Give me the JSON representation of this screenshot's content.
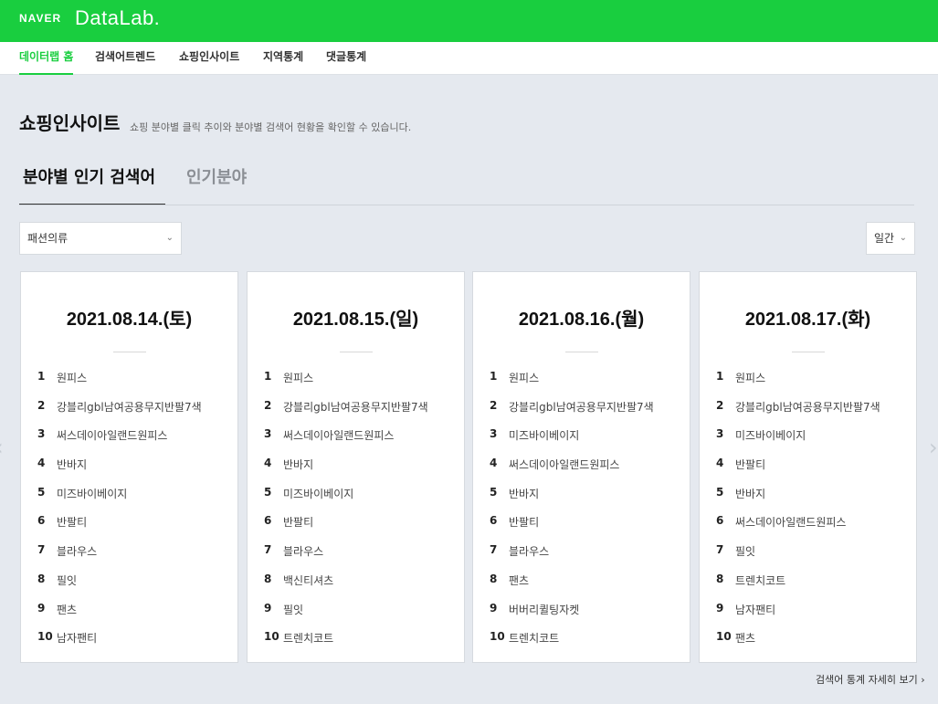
{
  "header": {
    "brand": "NAVER",
    "product": "DataLab."
  },
  "nav": {
    "items": [
      {
        "label": "데이터랩 홈",
        "active": true
      },
      {
        "label": "검색어트렌드",
        "active": false
      },
      {
        "label": "쇼핑인사이트",
        "active": false
      },
      {
        "label": "지역통계",
        "active": false
      },
      {
        "label": "댓글통계",
        "active": false
      }
    ]
  },
  "page": {
    "title": "쇼핑인사이트",
    "description": "쇼핑 분야별 클릭 추이와 분야별 검색어 현황을 확인할 수 있습니다."
  },
  "tabs": [
    {
      "label": "분야별 인기 검색어",
      "active": true
    },
    {
      "label": "인기분야",
      "active": false
    }
  ],
  "filters": {
    "category": {
      "value": "패션의류",
      "icon": "chevron-down-icon"
    },
    "period": {
      "value": "일간",
      "icon": "chevron-down-icon"
    }
  },
  "cards": [
    {
      "date": "2021.08.14.(토)",
      "items": [
        {
          "rank": "1",
          "keyword": "원피스"
        },
        {
          "rank": "2",
          "keyword": "강블리gbl남여공용무지반팔7색"
        },
        {
          "rank": "3",
          "keyword": "써스데이아일랜드원피스"
        },
        {
          "rank": "4",
          "keyword": "반바지"
        },
        {
          "rank": "5",
          "keyword": "미즈바이베이지"
        },
        {
          "rank": "6",
          "keyword": "반팔티"
        },
        {
          "rank": "7",
          "keyword": "블라우스"
        },
        {
          "rank": "8",
          "keyword": "필잇"
        },
        {
          "rank": "9",
          "keyword": "팬츠"
        },
        {
          "rank": "10",
          "keyword": "남자팬티"
        }
      ]
    },
    {
      "date": "2021.08.15.(일)",
      "items": [
        {
          "rank": "1",
          "keyword": "원피스"
        },
        {
          "rank": "2",
          "keyword": "강블리gbl남여공용무지반팔7색"
        },
        {
          "rank": "3",
          "keyword": "써스데이아일랜드원피스"
        },
        {
          "rank": "4",
          "keyword": "반바지"
        },
        {
          "rank": "5",
          "keyword": "미즈바이베이지"
        },
        {
          "rank": "6",
          "keyword": "반팔티"
        },
        {
          "rank": "7",
          "keyword": "블라우스"
        },
        {
          "rank": "8",
          "keyword": "백신티셔츠"
        },
        {
          "rank": "9",
          "keyword": "필잇"
        },
        {
          "rank": "10",
          "keyword": "트렌치코트"
        }
      ]
    },
    {
      "date": "2021.08.16.(월)",
      "items": [
        {
          "rank": "1",
          "keyword": "원피스"
        },
        {
          "rank": "2",
          "keyword": "강블리gbl남여공용무지반팔7색"
        },
        {
          "rank": "3",
          "keyword": "미즈바이베이지"
        },
        {
          "rank": "4",
          "keyword": "써스데이아일랜드원피스"
        },
        {
          "rank": "5",
          "keyword": "반바지"
        },
        {
          "rank": "6",
          "keyword": "반팔티"
        },
        {
          "rank": "7",
          "keyword": "블라우스"
        },
        {
          "rank": "8",
          "keyword": "팬츠"
        },
        {
          "rank": "9",
          "keyword": "버버리퀼팅자켓"
        },
        {
          "rank": "10",
          "keyword": "트렌치코트"
        }
      ]
    },
    {
      "date": "2021.08.17.(화)",
      "items": [
        {
          "rank": "1",
          "keyword": "원피스"
        },
        {
          "rank": "2",
          "keyword": "강블리gbl남여공용무지반팔7색"
        },
        {
          "rank": "3",
          "keyword": "미즈바이베이지"
        },
        {
          "rank": "4",
          "keyword": "반팔티"
        },
        {
          "rank": "5",
          "keyword": "반바지"
        },
        {
          "rank": "6",
          "keyword": "써스데이아일랜드원피스"
        },
        {
          "rank": "7",
          "keyword": "필잇"
        },
        {
          "rank": "8",
          "keyword": "트렌치코트"
        },
        {
          "rank": "9",
          "keyword": "남자팬티"
        },
        {
          "rank": "10",
          "keyword": "팬츠"
        }
      ]
    }
  ],
  "carousel": {
    "prev_icon": "chevron-left-icon",
    "next_icon": "chevron-right-icon"
  },
  "footer": {
    "more_label": "검색어 통계 자세히 보기",
    "more_icon": "chevron-right-icon"
  },
  "colors": {
    "brand_green": "#19ce3f",
    "background": "#e5e9ef"
  }
}
